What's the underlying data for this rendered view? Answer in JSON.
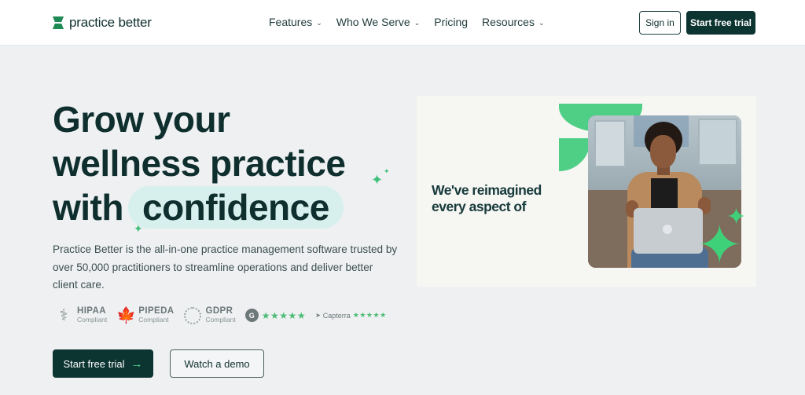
{
  "brand": {
    "name": "practice better"
  },
  "nav": {
    "items": [
      {
        "label": "Features",
        "has_dropdown": true
      },
      {
        "label": "Who We Serve",
        "has_dropdown": true
      },
      {
        "label": "Pricing",
        "has_dropdown": false
      },
      {
        "label": "Resources",
        "has_dropdown": true
      }
    ],
    "signin_label": "Sign in",
    "trial_label": "Start free trial"
  },
  "hero": {
    "headline_line1": "Grow your",
    "headline_line2": "wellness practice",
    "headline_with": "with",
    "headline_highlight": "confidence",
    "lead": "Practice Better is the all-in-one practice management software trusted by over 50,000 practitioners to streamline operations and deliver better client care.",
    "cta_primary": "Start free trial",
    "cta_secondary": "Watch a demo"
  },
  "compliance": [
    {
      "name": "HIPAA",
      "sub": "Compliant",
      "icon": "caduceus-icon"
    },
    {
      "name": "PIPEDA",
      "sub": "Compliant",
      "icon": "maple-leaf-icon"
    },
    {
      "name": "GDPR",
      "sub": "Compliant",
      "icon": "eu-stars-icon"
    }
  ],
  "ratings": {
    "g2_logo": "G",
    "g2_stars": "★★★★★",
    "capterra_label": "Capterra",
    "capterra_stars": "★★★★★"
  },
  "media": {
    "caption_line1": "We've reimagined",
    "caption_line2": "every aspect of"
  },
  "colors": {
    "primary": "#0c3431",
    "accent": "#4fcf86",
    "highlight": "#d7f0ee",
    "background": "#eef0f2"
  }
}
